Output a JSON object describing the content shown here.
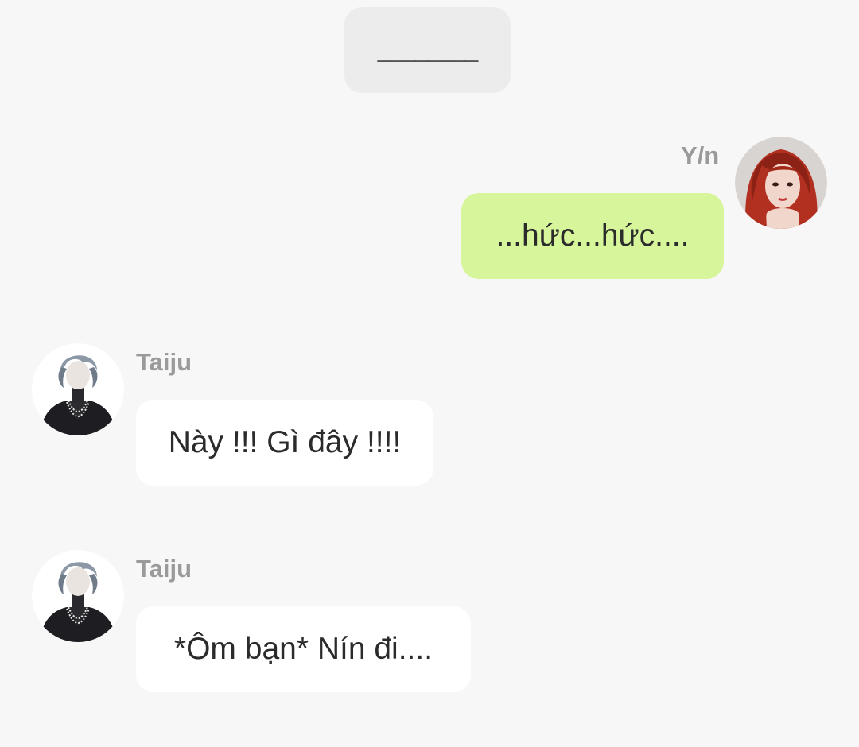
{
  "system_message": {
    "text": "________"
  },
  "messages": [
    {
      "sender": "Y/n",
      "text": "...hức...hức....",
      "direction": "outgoing",
      "avatar": "red-haired-woman-avatar"
    },
    {
      "sender": "Taiju",
      "text": "Này !!! Gì đây !!!!",
      "direction": "incoming",
      "avatar": "taiju-avatar"
    },
    {
      "sender": "Taiju",
      "text": "*Ôm bạn* Nín đi....",
      "direction": "incoming",
      "avatar": "taiju-avatar"
    }
  ],
  "colors": {
    "background": "#f7f7f7",
    "outgoing_bubble": "#d7f59a",
    "incoming_bubble": "#ffffff",
    "system_pill": "#ececec",
    "sender_name": "#9a9a9a",
    "message_text": "#2b2b2b"
  }
}
